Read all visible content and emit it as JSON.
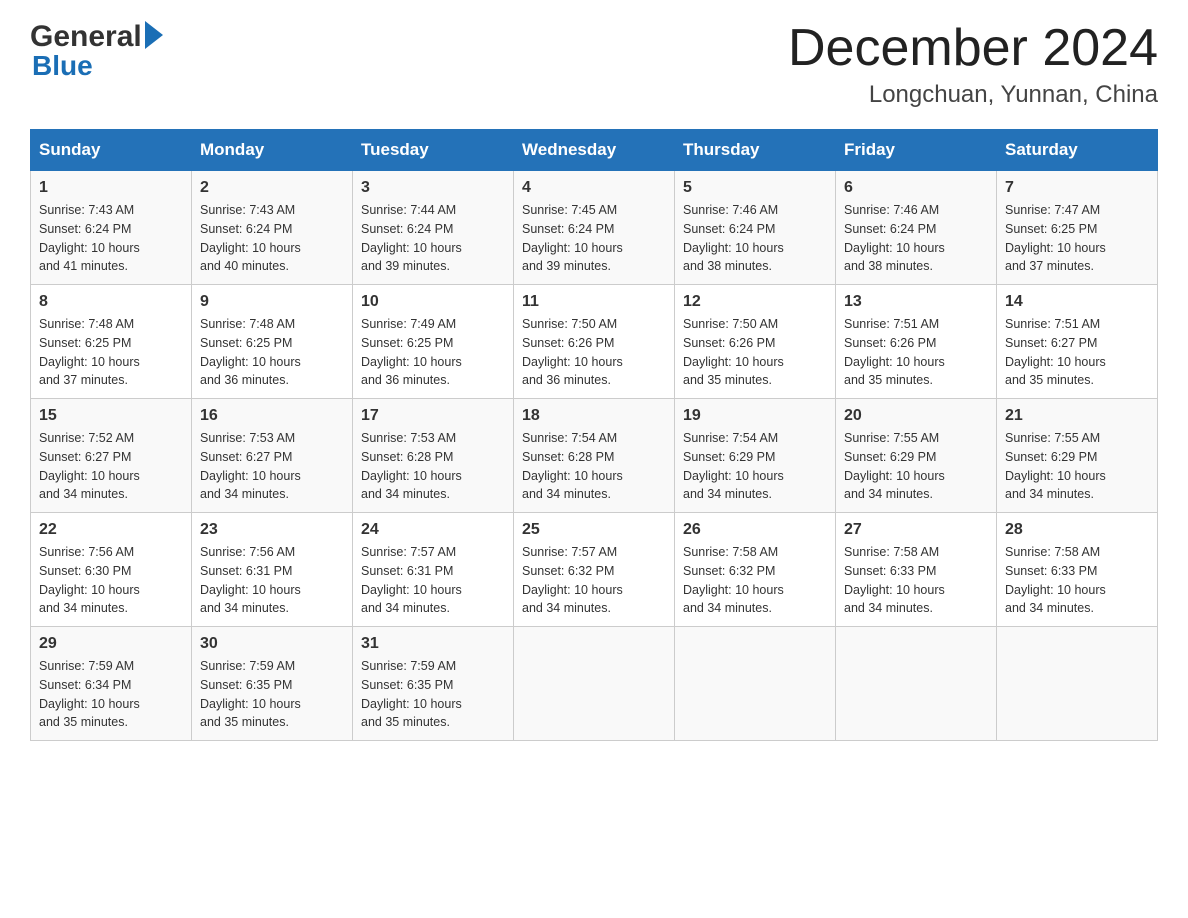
{
  "logo": {
    "part1": "General",
    "part2": "Blue"
  },
  "title": "December 2024",
  "subtitle": "Longchuan, Yunnan, China",
  "days_of_week": [
    "Sunday",
    "Monday",
    "Tuesday",
    "Wednesday",
    "Thursday",
    "Friday",
    "Saturday"
  ],
  "weeks": [
    [
      {
        "day": "1",
        "sunrise": "7:43 AM",
        "sunset": "6:24 PM",
        "daylight": "10 hours and 41 minutes."
      },
      {
        "day": "2",
        "sunrise": "7:43 AM",
        "sunset": "6:24 PM",
        "daylight": "10 hours and 40 minutes."
      },
      {
        "day": "3",
        "sunrise": "7:44 AM",
        "sunset": "6:24 PM",
        "daylight": "10 hours and 39 minutes."
      },
      {
        "day": "4",
        "sunrise": "7:45 AM",
        "sunset": "6:24 PM",
        "daylight": "10 hours and 39 minutes."
      },
      {
        "day": "5",
        "sunrise": "7:46 AM",
        "sunset": "6:24 PM",
        "daylight": "10 hours and 38 minutes."
      },
      {
        "day": "6",
        "sunrise": "7:46 AM",
        "sunset": "6:24 PM",
        "daylight": "10 hours and 38 minutes."
      },
      {
        "day": "7",
        "sunrise": "7:47 AM",
        "sunset": "6:25 PM",
        "daylight": "10 hours and 37 minutes."
      }
    ],
    [
      {
        "day": "8",
        "sunrise": "7:48 AM",
        "sunset": "6:25 PM",
        "daylight": "10 hours and 37 minutes."
      },
      {
        "day": "9",
        "sunrise": "7:48 AM",
        "sunset": "6:25 PM",
        "daylight": "10 hours and 36 minutes."
      },
      {
        "day": "10",
        "sunrise": "7:49 AM",
        "sunset": "6:25 PM",
        "daylight": "10 hours and 36 minutes."
      },
      {
        "day": "11",
        "sunrise": "7:50 AM",
        "sunset": "6:26 PM",
        "daylight": "10 hours and 36 minutes."
      },
      {
        "day": "12",
        "sunrise": "7:50 AM",
        "sunset": "6:26 PM",
        "daylight": "10 hours and 35 minutes."
      },
      {
        "day": "13",
        "sunrise": "7:51 AM",
        "sunset": "6:26 PM",
        "daylight": "10 hours and 35 minutes."
      },
      {
        "day": "14",
        "sunrise": "7:51 AM",
        "sunset": "6:27 PM",
        "daylight": "10 hours and 35 minutes."
      }
    ],
    [
      {
        "day": "15",
        "sunrise": "7:52 AM",
        "sunset": "6:27 PM",
        "daylight": "10 hours and 34 minutes."
      },
      {
        "day": "16",
        "sunrise": "7:53 AM",
        "sunset": "6:27 PM",
        "daylight": "10 hours and 34 minutes."
      },
      {
        "day": "17",
        "sunrise": "7:53 AM",
        "sunset": "6:28 PM",
        "daylight": "10 hours and 34 minutes."
      },
      {
        "day": "18",
        "sunrise": "7:54 AM",
        "sunset": "6:28 PM",
        "daylight": "10 hours and 34 minutes."
      },
      {
        "day": "19",
        "sunrise": "7:54 AM",
        "sunset": "6:29 PM",
        "daylight": "10 hours and 34 minutes."
      },
      {
        "day": "20",
        "sunrise": "7:55 AM",
        "sunset": "6:29 PM",
        "daylight": "10 hours and 34 minutes."
      },
      {
        "day": "21",
        "sunrise": "7:55 AM",
        "sunset": "6:29 PM",
        "daylight": "10 hours and 34 minutes."
      }
    ],
    [
      {
        "day": "22",
        "sunrise": "7:56 AM",
        "sunset": "6:30 PM",
        "daylight": "10 hours and 34 minutes."
      },
      {
        "day": "23",
        "sunrise": "7:56 AM",
        "sunset": "6:31 PM",
        "daylight": "10 hours and 34 minutes."
      },
      {
        "day": "24",
        "sunrise": "7:57 AM",
        "sunset": "6:31 PM",
        "daylight": "10 hours and 34 minutes."
      },
      {
        "day": "25",
        "sunrise": "7:57 AM",
        "sunset": "6:32 PM",
        "daylight": "10 hours and 34 minutes."
      },
      {
        "day": "26",
        "sunrise": "7:58 AM",
        "sunset": "6:32 PM",
        "daylight": "10 hours and 34 minutes."
      },
      {
        "day": "27",
        "sunrise": "7:58 AM",
        "sunset": "6:33 PM",
        "daylight": "10 hours and 34 minutes."
      },
      {
        "day": "28",
        "sunrise": "7:58 AM",
        "sunset": "6:33 PM",
        "daylight": "10 hours and 34 minutes."
      }
    ],
    [
      {
        "day": "29",
        "sunrise": "7:59 AM",
        "sunset": "6:34 PM",
        "daylight": "10 hours and 35 minutes."
      },
      {
        "day": "30",
        "sunrise": "7:59 AM",
        "sunset": "6:35 PM",
        "daylight": "10 hours and 35 minutes."
      },
      {
        "day": "31",
        "sunrise": "7:59 AM",
        "sunset": "6:35 PM",
        "daylight": "10 hours and 35 minutes."
      },
      null,
      null,
      null,
      null
    ]
  ],
  "labels": {
    "sunrise": "Sunrise:",
    "sunset": "Sunset:",
    "daylight": "Daylight:"
  }
}
